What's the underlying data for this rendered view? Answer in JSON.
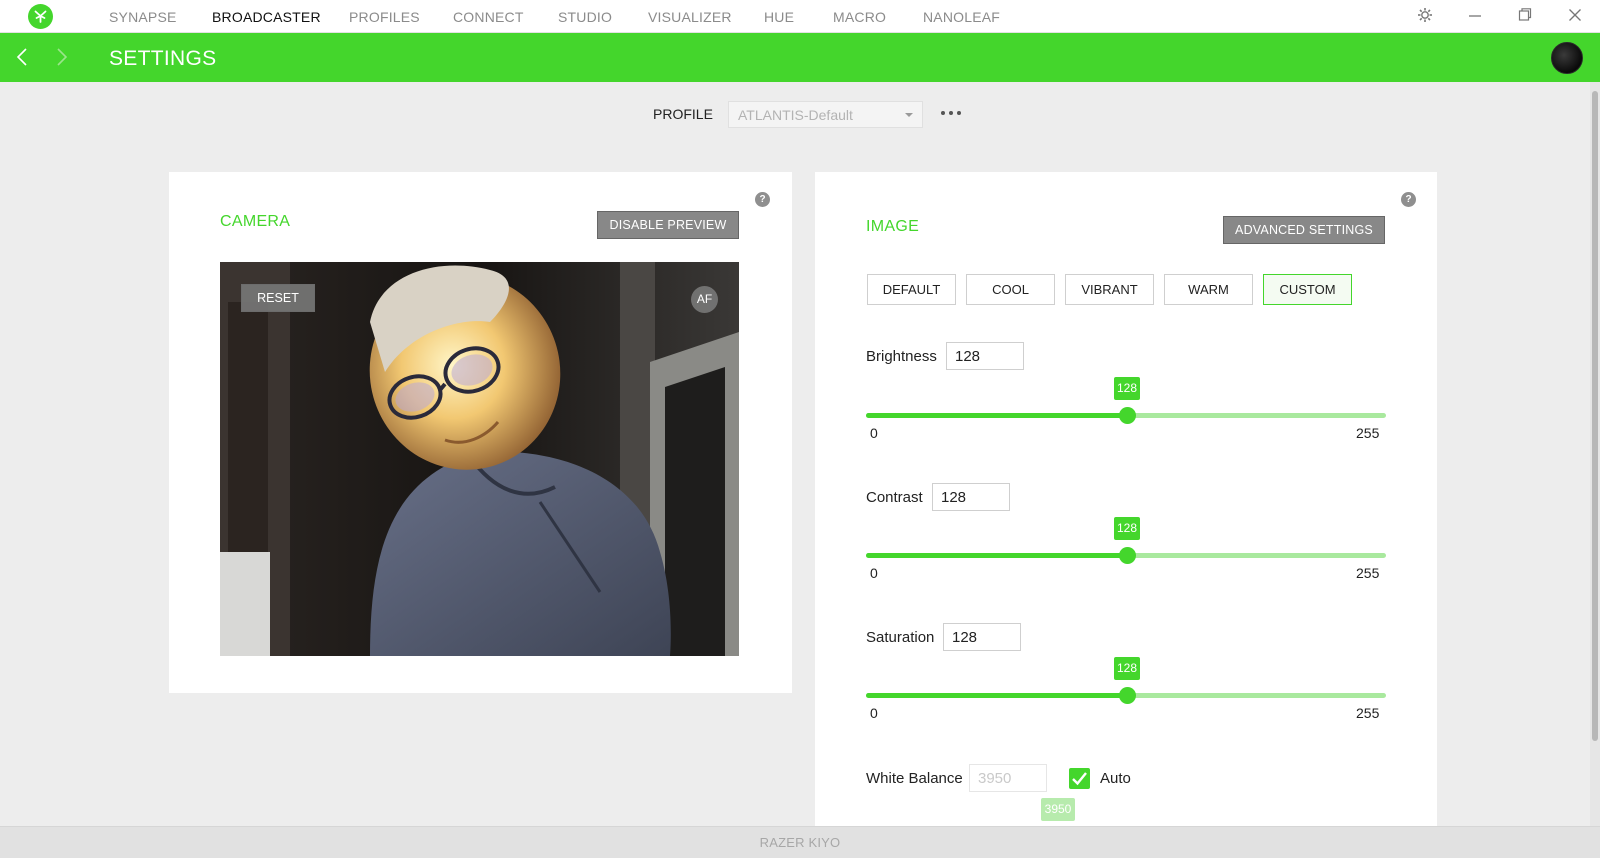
{
  "nav": {
    "items": [
      {
        "label": "SYNAPSE",
        "active": false
      },
      {
        "label": "BROADCASTER",
        "active": true
      },
      {
        "label": "PROFILES",
        "active": false
      },
      {
        "label": "CONNECT",
        "active": false
      },
      {
        "label": "STUDIO",
        "active": false
      },
      {
        "label": "VISUALIZER",
        "active": false
      },
      {
        "label": "HUE",
        "active": false
      },
      {
        "label": "MACRO",
        "active": false
      },
      {
        "label": "NANOLEAF",
        "active": false
      }
    ]
  },
  "header": {
    "title": "SETTINGS"
  },
  "profile": {
    "label": "PROFILE",
    "selected": "ATLANTIS-Default"
  },
  "camera": {
    "title": "CAMERA",
    "disable_preview_label": "DISABLE PREVIEW",
    "reset_label": "RESET",
    "af_label": "AF",
    "help": "?"
  },
  "image": {
    "title": "IMAGE",
    "advanced_label": "ADVANCED SETTINGS",
    "help": "?",
    "presets": [
      {
        "label": "DEFAULT",
        "selected": false
      },
      {
        "label": "COOL",
        "selected": false
      },
      {
        "label": "VIBRANT",
        "selected": false
      },
      {
        "label": "WARM",
        "selected": false
      },
      {
        "label": "CUSTOM",
        "selected": true
      }
    ],
    "sliders": [
      {
        "label": "Brightness",
        "value": "128",
        "min": "0",
        "max": "255"
      },
      {
        "label": "Contrast",
        "value": "128",
        "min": "0",
        "max": "255"
      },
      {
        "label": "Saturation",
        "value": "128",
        "min": "0",
        "max": "255"
      }
    ],
    "white_balance": {
      "label": "White Balance",
      "value": "3950",
      "auto_label": "Auto",
      "auto_checked": true
    }
  },
  "footer": {
    "device": "RAZER KIYO"
  },
  "colors": {
    "accent": "#44d62c",
    "panel": "#ffffff",
    "background": "#ededed"
  }
}
